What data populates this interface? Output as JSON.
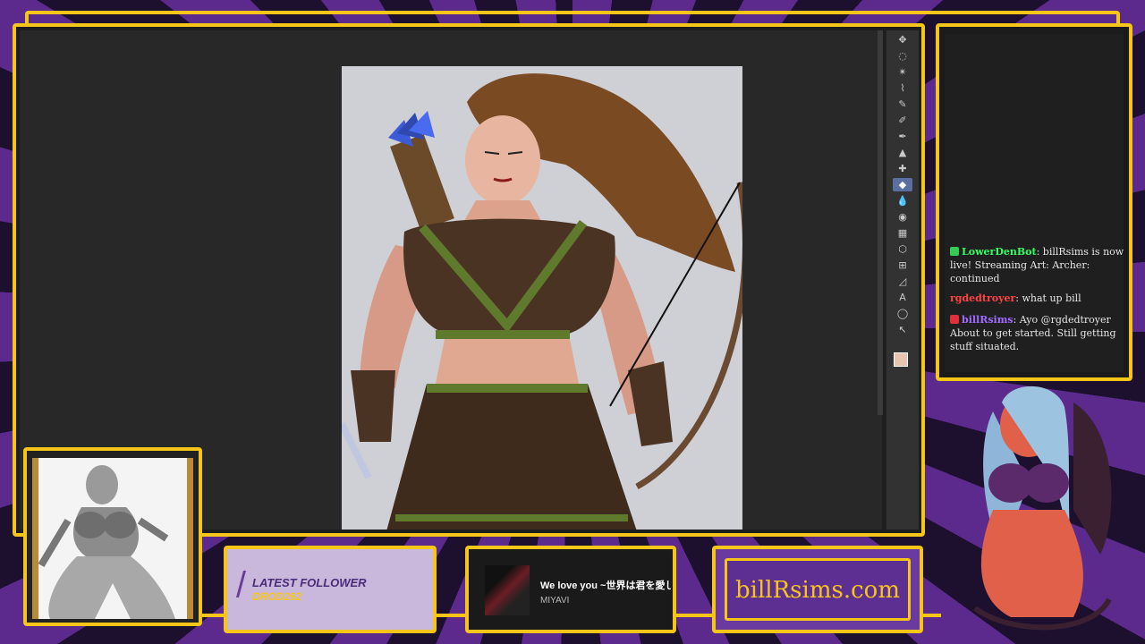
{
  "colors": {
    "accent": "#f5c518",
    "purple": "#6b3aa0",
    "canvas_bg": "#282828"
  },
  "toolbar": {
    "tools": [
      "move-icon",
      "lasso-icon",
      "magic-wand-icon",
      "eyedropper-icon",
      "brush-icon",
      "pencil-icon",
      "pen-icon",
      "stamp-icon",
      "heal-icon",
      "eraser-icon",
      "blur-icon",
      "bucket-icon",
      "gradient-icon",
      "shape-icon",
      "crop-icon",
      "path-icon",
      "text-icon",
      "speech-icon",
      "select-icon"
    ],
    "glyphs": [
      "✥",
      "◌",
      "✴",
      "⌇",
      "✎",
      "✐",
      "✒",
      "▲",
      "✚",
      "◆",
      "💧",
      "◉",
      "▦",
      "⬡",
      "⊞",
      "◿",
      "A",
      "◯",
      "↖"
    ]
  },
  "chat": {
    "messages": [
      {
        "user": "LowerDenBot",
        "user_color": "#33ff66",
        "text": "billRsims is now live! Streaming Art: Archer: continued",
        "badge_color": "#33cc55"
      },
      {
        "user": "rgdedtroyer",
        "user_color": "#ff4444",
        "text": "what up bill",
        "badge_color": ""
      },
      {
        "user": "billRsims",
        "user_color": "#a06bff",
        "text": "Ayo @rgdedtroyer About to get started. Still getting stuff situated.",
        "badge_color": "#e0303a"
      }
    ]
  },
  "follower": {
    "title": "LATEST FOLLOWER",
    "name": "DROD262"
  },
  "music": {
    "title": "We love you ~世界は君を愛し",
    "artist": "MIYAVI"
  },
  "website": {
    "text": "billRsims.com"
  }
}
